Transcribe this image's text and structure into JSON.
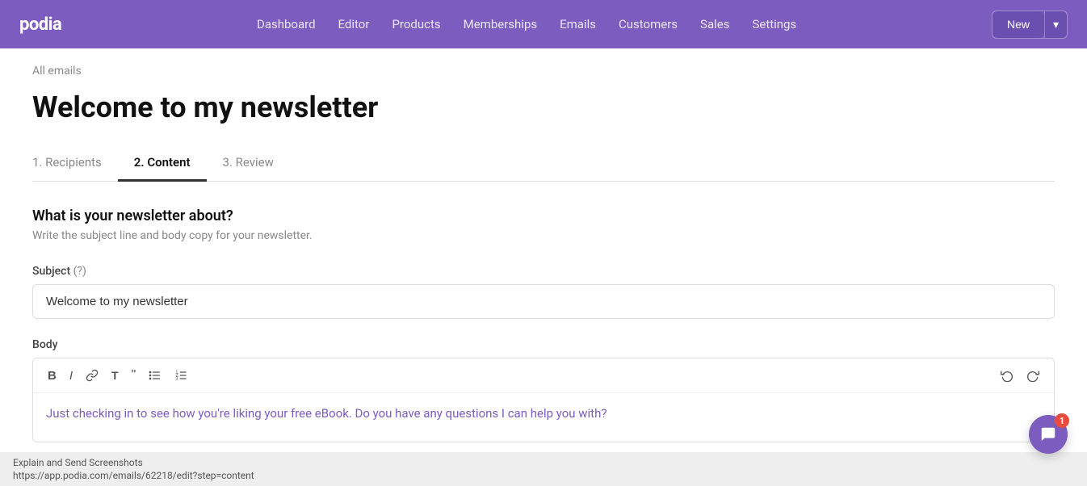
{
  "brand": {
    "logo": "podia"
  },
  "nav": {
    "links": [
      {
        "id": "dashboard",
        "label": "Dashboard"
      },
      {
        "id": "editor",
        "label": "Editor"
      },
      {
        "id": "products",
        "label": "Products"
      },
      {
        "id": "memberships",
        "label": "Memberships"
      },
      {
        "id": "emails",
        "label": "Emails"
      },
      {
        "id": "customers",
        "label": "Customers"
      },
      {
        "id": "sales",
        "label": "Sales"
      },
      {
        "id": "settings",
        "label": "Settings"
      }
    ],
    "new_button_label": "New",
    "new_button_arrow": "▾"
  },
  "breadcrumb": {
    "text": "All emails"
  },
  "page": {
    "title": "Welcome to my newsletter"
  },
  "tabs": [
    {
      "id": "recipients",
      "label": "1. Recipients",
      "active": false
    },
    {
      "id": "content",
      "label": "2. Content",
      "active": true
    },
    {
      "id": "review",
      "label": "3. Review",
      "active": false
    }
  ],
  "section": {
    "title": "What is your newsletter about?",
    "description": "Write the subject line and body copy for your newsletter."
  },
  "subject_field": {
    "label": "Subject",
    "help": "(?)",
    "value": "Welcome to my newsletter"
  },
  "body_field": {
    "label": "Body"
  },
  "toolbar": {
    "bold": "B",
    "italic": "I",
    "link": "🔗",
    "format": "T",
    "quote": "❝",
    "list_unordered": "≡",
    "list_ordered": "≣",
    "undo": "↩",
    "redo": "↪"
  },
  "editor_content": "Just checking in to see how you're liking your free eBook. Do you have any questions I can help you with?",
  "bottom_bar": {
    "line1": "Explain and Send Screenshots",
    "line2": "https://app.podia.com/emails/62218/edit?step=content"
  },
  "chat": {
    "badge_count": "1"
  }
}
